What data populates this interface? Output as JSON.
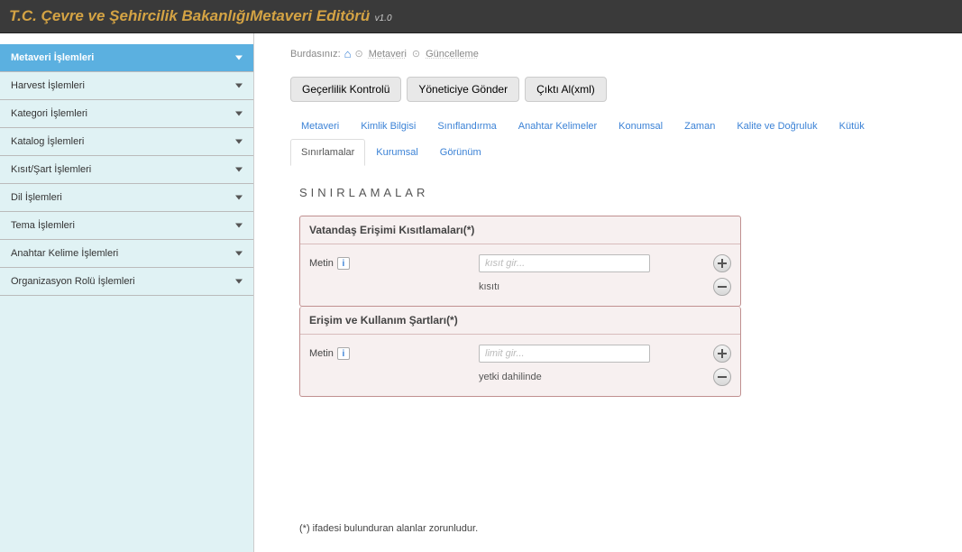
{
  "header": {
    "title": "T.C. Çevre ve Şehircilik BakanlığıMetaveri Editörü",
    "version": "v1.0"
  },
  "sidebar": {
    "items": [
      {
        "label": "Metaveri İşlemleri",
        "active": true
      },
      {
        "label": "Harvest İşlemleri"
      },
      {
        "label": "Kategori İşlemleri"
      },
      {
        "label": "Katalog İşlemleri"
      },
      {
        "label": "Kısıt/Şart İşlemleri"
      },
      {
        "label": "Dil İşlemleri"
      },
      {
        "label": "Tema İşlemleri"
      },
      {
        "label": "Anahtar Kelime İşlemleri"
      },
      {
        "label": "Organizasyon Rolü İşlemleri"
      }
    ]
  },
  "breadcrumb": {
    "label": "Burdasınız:",
    "items": [
      "Metaveri",
      "Güncelleme"
    ]
  },
  "actions": {
    "validate": "Geçerlilik Kontrolü",
    "send": "Yöneticiye Gönder",
    "export": "Çıktı Al(xml)"
  },
  "tabs": [
    {
      "label": "Metaveri"
    },
    {
      "label": "Kimlik Bilgisi"
    },
    {
      "label": "Sınıflandırma"
    },
    {
      "label": "Anahtar Kelimeler"
    },
    {
      "label": "Konumsal"
    },
    {
      "label": "Zaman"
    },
    {
      "label": "Kalite ve Doğruluk"
    },
    {
      "label": "Kütük"
    },
    {
      "label": "Sınırlamalar",
      "active": true
    },
    {
      "label": "Kurumsal"
    },
    {
      "label": "Görünüm"
    }
  ],
  "section": {
    "title": "SINIRLAMALAR"
  },
  "panels": [
    {
      "title": "Vatandaş Erişimi Kısıtlamaları(*)",
      "field_label": "Metin",
      "placeholder": "kısıt gir...",
      "value": "kısıtı"
    },
    {
      "title": "Erişim ve Kullanım Şartları(*)",
      "field_label": "Metin",
      "placeholder": "limit gir...",
      "value": "yetki dahilinde"
    }
  ],
  "footnote": "(*) ifadesi bulunduran alanlar zorunludur."
}
